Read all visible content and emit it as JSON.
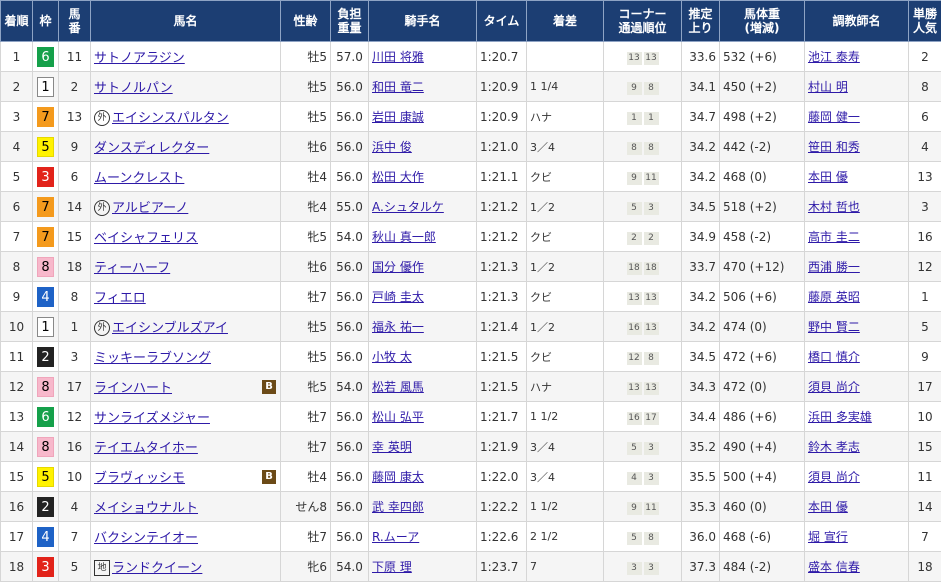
{
  "colors": {
    "header_bg": "#1c3e73",
    "link": "#2e1aa8",
    "blinker_bg": "#6b4a17"
  },
  "headers": {
    "rank": "着順",
    "waku": "枠",
    "umaban": [
      "馬",
      "番"
    ],
    "horse": "馬名",
    "sex_age": "性齢",
    "weight_carried": [
      "負担",
      "重量"
    ],
    "jockey": "騎手名",
    "time": "タイム",
    "margin": "着差",
    "corner": [
      "コーナー",
      "通過順位"
    ],
    "last3f": [
      "推定",
      "上り"
    ],
    "body_weight": [
      "馬体重",
      "(増減)"
    ],
    "trainer": "調教師名",
    "popularity": [
      "単勝",
      "人気"
    ]
  },
  "waku_colors": {
    "1": {
      "bg": "#ffffff",
      "fg": "#000000",
      "border": "#888888"
    },
    "2": {
      "bg": "#222222",
      "fg": "#ffffff",
      "border": "#222222"
    },
    "3": {
      "bg": "#e2231a",
      "fg": "#ffffff",
      "border": "#e2231a"
    },
    "4": {
      "bg": "#1e62c6",
      "fg": "#ffffff",
      "border": "#1e62c6"
    },
    "5": {
      "bg": "#fff200",
      "fg": "#000000",
      "border": "#e6d800"
    },
    "6": {
      "bg": "#15a04a",
      "fg": "#ffffff",
      "border": "#15a04a"
    },
    "7": {
      "bg": "#f49a1d",
      "fg": "#000000",
      "border": "#f49a1d"
    },
    "8": {
      "bg": "#f7b8cb",
      "fg": "#000000",
      "border": "#f0a5bb"
    }
  },
  "rows": [
    {
      "rank": "1",
      "waku": "6",
      "umaban": "11",
      "tag": "",
      "horse": "サトノアラジン",
      "blinker": false,
      "sex_age": "牡5",
      "weight": "57.0",
      "jockey": "川田 将雅",
      "time": "1:20.7",
      "margin": "",
      "corners": [
        "13",
        "13"
      ],
      "last3f": "33.6",
      "body_weight": "532 (+6)",
      "trainer": "池江 泰寿",
      "popularity": "2"
    },
    {
      "rank": "2",
      "waku": "1",
      "umaban": "2",
      "tag": "",
      "horse": "サトノルパン",
      "blinker": false,
      "sex_age": "牡5",
      "weight": "56.0",
      "jockey": "和田 竜二",
      "time": "1:20.9",
      "margin": "1 1/4",
      "corners": [
        "9",
        "8"
      ],
      "last3f": "34.1",
      "body_weight": "450 (+2)",
      "trainer": "村山 明",
      "popularity": "8"
    },
    {
      "rank": "3",
      "waku": "7",
      "umaban": "13",
      "tag": "外",
      "horse": "エイシンスパルタン",
      "blinker": false,
      "sex_age": "牡5",
      "weight": "56.0",
      "jockey": "岩田 康誠",
      "time": "1:20.9",
      "margin": "ハナ",
      "corners": [
        "1",
        "1"
      ],
      "last3f": "34.7",
      "body_weight": "498 (+2)",
      "trainer": "藤岡 健一",
      "popularity": "6"
    },
    {
      "rank": "4",
      "waku": "5",
      "umaban": "9",
      "tag": "",
      "horse": "ダンスディレクター",
      "blinker": false,
      "sex_age": "牡6",
      "weight": "56.0",
      "jockey": "浜中 俊",
      "time": "1:21.0",
      "margin": "3／4",
      "corners": [
        "8",
        "8"
      ],
      "last3f": "34.2",
      "body_weight": "442 (-2)",
      "trainer": "笹田 和秀",
      "popularity": "4"
    },
    {
      "rank": "5",
      "waku": "3",
      "umaban": "6",
      "tag": "",
      "horse": "ムーンクレスト",
      "blinker": false,
      "sex_age": "牡4",
      "weight": "56.0",
      "jockey": "松田 大作",
      "time": "1:21.1",
      "margin": "クビ",
      "corners": [
        "9",
        "11"
      ],
      "last3f": "34.2",
      "body_weight": "468 (0)",
      "trainer": "本田 優",
      "popularity": "13"
    },
    {
      "rank": "6",
      "waku": "7",
      "umaban": "14",
      "tag": "外",
      "horse": "アルビアーノ",
      "blinker": false,
      "sex_age": "牝4",
      "weight": "55.0",
      "jockey": "A.シュタルケ",
      "time": "1:21.2",
      "margin": "1／2",
      "corners": [
        "5",
        "3"
      ],
      "last3f": "34.5",
      "body_weight": "518 (+2)",
      "trainer": "木村 哲也",
      "popularity": "3"
    },
    {
      "rank": "7",
      "waku": "7",
      "umaban": "15",
      "tag": "",
      "horse": "ベイシャフェリス",
      "blinker": false,
      "sex_age": "牝5",
      "weight": "54.0",
      "jockey": "秋山 真一郎",
      "time": "1:21.2",
      "margin": "クビ",
      "corners": [
        "2",
        "2"
      ],
      "last3f": "34.9",
      "body_weight": "458 (-2)",
      "trainer": "高市 圭二",
      "popularity": "16"
    },
    {
      "rank": "8",
      "waku": "8",
      "umaban": "18",
      "tag": "",
      "horse": "ティーハーフ",
      "blinker": false,
      "sex_age": "牡6",
      "weight": "56.0",
      "jockey": "国分 優作",
      "time": "1:21.3",
      "margin": "1／2",
      "corners": [
        "18",
        "18"
      ],
      "last3f": "33.7",
      "body_weight": "470 (+12)",
      "trainer": "西浦 勝一",
      "popularity": "12"
    },
    {
      "rank": "9",
      "waku": "4",
      "umaban": "8",
      "tag": "",
      "horse": "フィエロ",
      "blinker": false,
      "sex_age": "牡7",
      "weight": "56.0",
      "jockey": "戸崎 圭太",
      "time": "1:21.3",
      "margin": "クビ",
      "corners": [
        "13",
        "13"
      ],
      "last3f": "34.2",
      "body_weight": "506 (+6)",
      "trainer": "藤原 英昭",
      "popularity": "1"
    },
    {
      "rank": "10",
      "waku": "1",
      "umaban": "1",
      "tag": "外",
      "horse": "エイシンブルズアイ",
      "blinker": false,
      "sex_age": "牡5",
      "weight": "56.0",
      "jockey": "福永 祐一",
      "time": "1:21.4",
      "margin": "1／2",
      "corners": [
        "16",
        "13"
      ],
      "last3f": "34.2",
      "body_weight": "474 (0)",
      "trainer": "野中 賢二",
      "popularity": "5"
    },
    {
      "rank": "11",
      "waku": "2",
      "umaban": "3",
      "tag": "",
      "horse": "ミッキーラブソング",
      "blinker": false,
      "sex_age": "牡5",
      "weight": "56.0",
      "jockey": "小牧 太",
      "time": "1:21.5",
      "margin": "クビ",
      "corners": [
        "12",
        "8"
      ],
      "last3f": "34.5",
      "body_weight": "472 (+6)",
      "trainer": "橋口 慎介",
      "popularity": "9"
    },
    {
      "rank": "12",
      "waku": "8",
      "umaban": "17",
      "tag": "",
      "horse": "ラインハート",
      "blinker": true,
      "sex_age": "牝5",
      "weight": "54.0",
      "jockey": "松若 風馬",
      "time": "1:21.5",
      "margin": "ハナ",
      "corners": [
        "13",
        "13"
      ],
      "last3f": "34.3",
      "body_weight": "472 (0)",
      "trainer": "須貝 尚介",
      "popularity": "17"
    },
    {
      "rank": "13",
      "waku": "6",
      "umaban": "12",
      "tag": "",
      "horse": "サンライズメジャー",
      "blinker": false,
      "sex_age": "牡7",
      "weight": "56.0",
      "jockey": "松山 弘平",
      "time": "1:21.7",
      "margin": "1 1/2",
      "corners": [
        "16",
        "17"
      ],
      "last3f": "34.4",
      "body_weight": "486 (+6)",
      "trainer": "浜田 多実雄",
      "popularity": "10"
    },
    {
      "rank": "14",
      "waku": "8",
      "umaban": "16",
      "tag": "",
      "horse": "テイエムタイホー",
      "blinker": false,
      "sex_age": "牡7",
      "weight": "56.0",
      "jockey": "幸 英明",
      "time": "1:21.9",
      "margin": "3／4",
      "corners": [
        "5",
        "3"
      ],
      "last3f": "35.2",
      "body_weight": "490 (+4)",
      "trainer": "鈴木 孝志",
      "popularity": "15"
    },
    {
      "rank": "15",
      "waku": "5",
      "umaban": "10",
      "tag": "",
      "horse": "ブラヴィッシモ",
      "blinker": true,
      "sex_age": "牡4",
      "weight": "56.0",
      "jockey": "藤岡 康太",
      "time": "1:22.0",
      "margin": "3／4",
      "corners": [
        "4",
        "3"
      ],
      "last3f": "35.5",
      "body_weight": "500 (+4)",
      "trainer": "須貝 尚介",
      "popularity": "11"
    },
    {
      "rank": "16",
      "waku": "2",
      "umaban": "4",
      "tag": "",
      "horse": "メイショウナルト",
      "blinker": false,
      "sex_age": "せん8",
      "weight": "56.0",
      "jockey": "武 幸四郎",
      "time": "1:22.2",
      "margin": "1 1/2",
      "corners": [
        "9",
        "11"
      ],
      "last3f": "35.3",
      "body_weight": "460 (0)",
      "trainer": "本田 優",
      "popularity": "14"
    },
    {
      "rank": "17",
      "waku": "4",
      "umaban": "7",
      "tag": "",
      "horse": "バクシンテイオー",
      "blinker": false,
      "sex_age": "牡7",
      "weight": "56.0",
      "jockey": "R.ムーア",
      "time": "1:22.6",
      "margin": "2 1/2",
      "corners": [
        "5",
        "8"
      ],
      "last3f": "36.0",
      "body_weight": "468 (-6)",
      "trainer": "堀 宣行",
      "popularity": "7"
    },
    {
      "rank": "18",
      "waku": "3",
      "umaban": "5",
      "tag": "地",
      "horse": "ランドクイーン",
      "blinker": false,
      "sex_age": "牝6",
      "weight": "54.0",
      "jockey": "下原 理",
      "time": "1:23.7",
      "margin": "7",
      "corners": [
        "3",
        "3"
      ],
      "last3f": "37.3",
      "body_weight": "484 (-2)",
      "trainer": "盛本 信春",
      "popularity": "18"
    }
  ]
}
